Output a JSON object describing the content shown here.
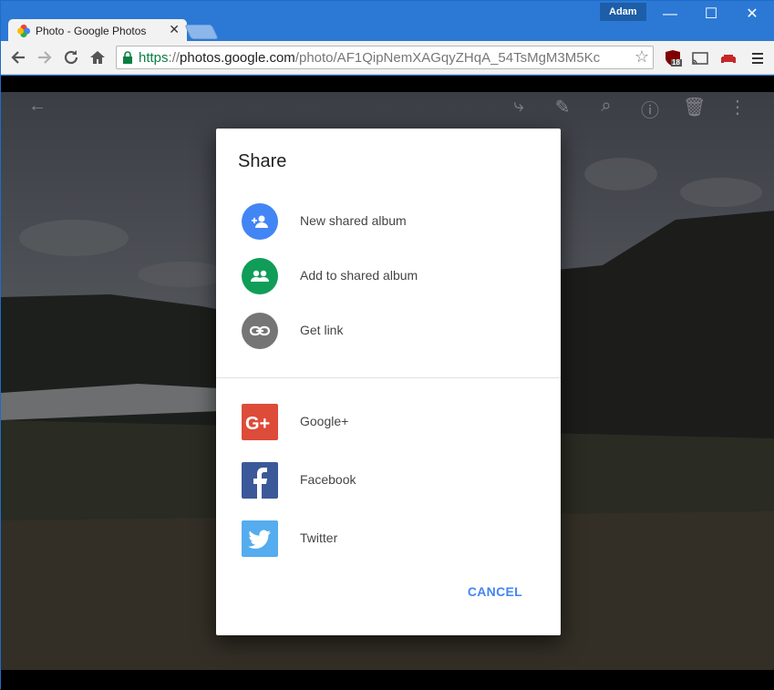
{
  "browser": {
    "tab_title": "Photo - Google Photos",
    "tab_close": "✕",
    "profile_name": "Adam",
    "window_controls": {
      "minimize": "—",
      "maximize": "☐",
      "close": "✕"
    },
    "url_scheme": "https",
    "url_sep": "://",
    "url_host": "photos.google.com",
    "url_path": "/photo/AF1QipNemXAGqyZHqA_54TsMgM3M5Kc",
    "ublock_count": "18"
  },
  "dialog": {
    "title": "Share",
    "items": [
      {
        "label": "New shared album",
        "icon": "group-add-icon",
        "color": "#4285f4"
      },
      {
        "label": "Add to shared album",
        "icon": "group-icon",
        "color": "#0f9d58"
      },
      {
        "label": "Get link",
        "icon": "link-icon",
        "color": "#757575"
      }
    ],
    "social": [
      {
        "label": "Google+",
        "icon": "google-plus-icon",
        "color": "#dd4b39"
      },
      {
        "label": "Facebook",
        "icon": "facebook-icon",
        "color": "#3b5998"
      },
      {
        "label": "Twitter",
        "icon": "twitter-icon",
        "color": "#55acee"
      }
    ],
    "cancel_label": "CANCEL"
  }
}
